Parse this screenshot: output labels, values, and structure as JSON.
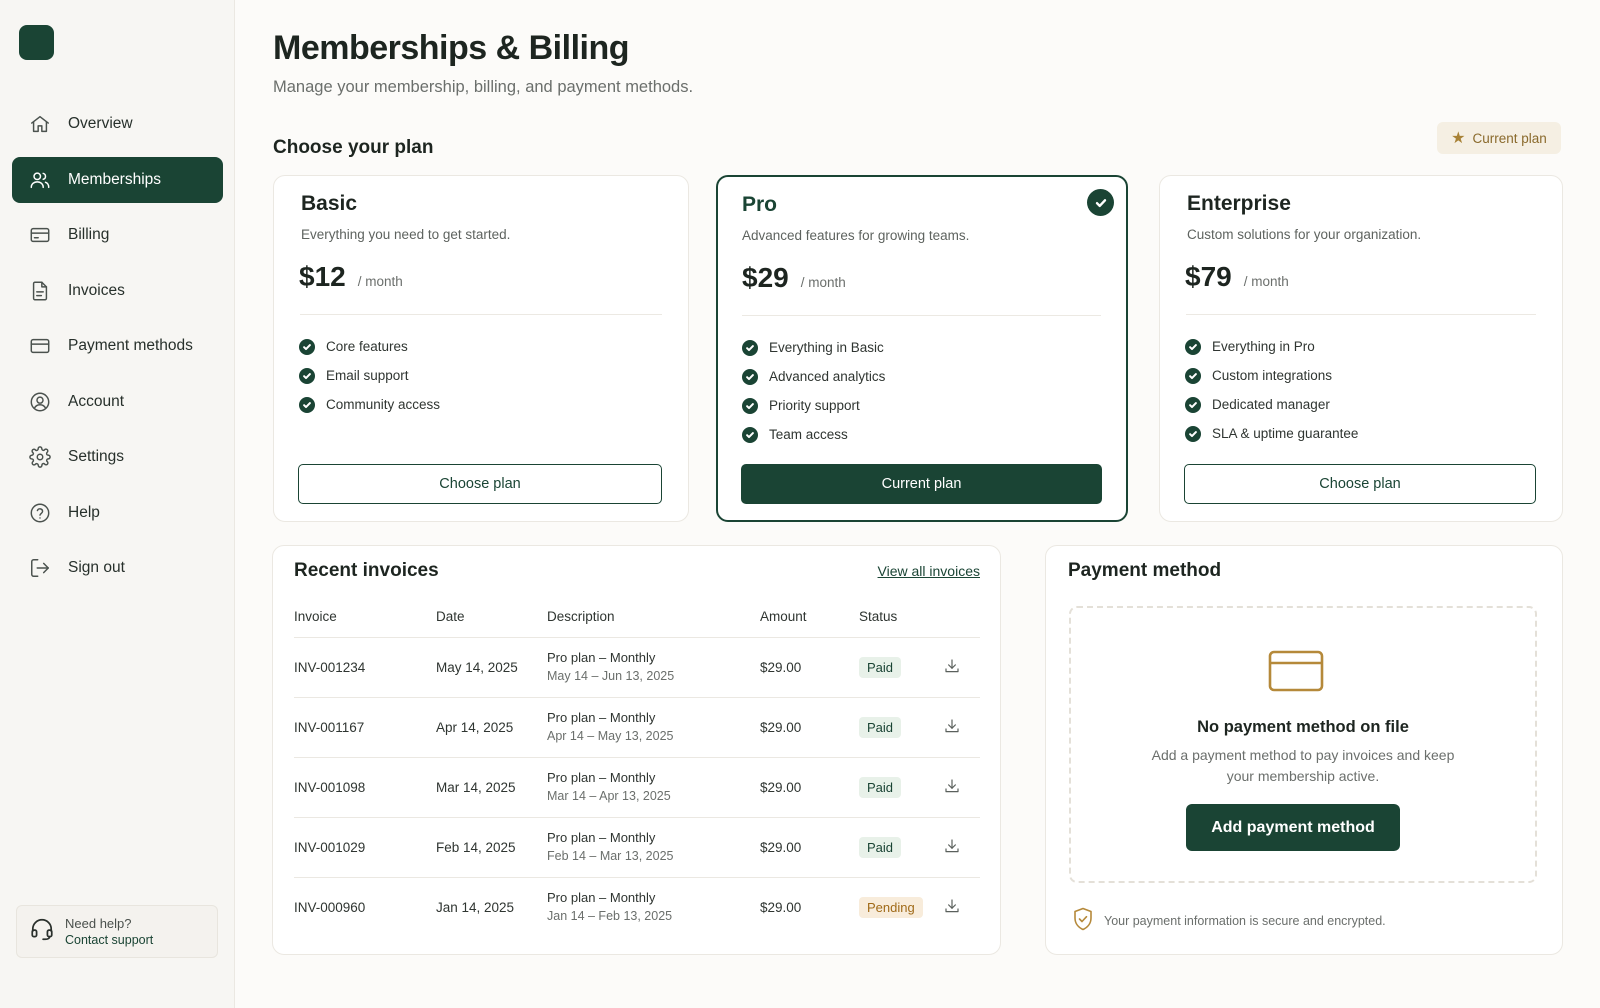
{
  "sidebar": {
    "items": [
      {
        "label": "Overview",
        "icon": "home-icon"
      },
      {
        "label": "Memberships",
        "icon": "users-icon",
        "active": true
      },
      {
        "label": "Billing",
        "icon": "credit-card-icon"
      },
      {
        "label": "Invoices",
        "icon": "file-icon"
      },
      {
        "label": "Payment methods",
        "icon": "credit-card-icon"
      },
      {
        "label": "Account",
        "icon": "user-circle-icon"
      },
      {
        "label": "Settings",
        "icon": "gear-icon"
      },
      {
        "label": "Help",
        "icon": "help-circle-icon"
      },
      {
        "label": "Sign out",
        "icon": "sign-out-icon"
      }
    ],
    "help": {
      "title": "Need help?",
      "link": "Contact support"
    }
  },
  "header": {
    "title": "Memberships & Billing",
    "subtitle": "Manage your membership, billing, and payment methods."
  },
  "plans_section": {
    "title": "Choose your plan",
    "current_pill": "Current plan"
  },
  "plans": [
    {
      "name": "Basic",
      "desc": "Everything you need to get started.",
      "price": "$12",
      "period": "/ month",
      "features": [
        "Core features",
        "Email support",
        "Community access"
      ],
      "button": "Choose plan"
    },
    {
      "name": "Pro",
      "desc": "Advanced features for growing teams.",
      "price": "$29",
      "period": "/ month",
      "features": [
        "Everything in Basic",
        "Advanced analytics",
        "Priority support",
        "Team access"
      ],
      "button": "Current plan"
    },
    {
      "name": "Enterprise",
      "desc": "Custom solutions for your organization.",
      "price": "$79",
      "period": "/ month",
      "features": [
        "Everything in Pro",
        "Custom integrations",
        "Dedicated manager",
        "SLA & uptime guarantee"
      ],
      "button": "Choose plan"
    }
  ],
  "invoices": {
    "title": "Recent invoices",
    "view_all": "View all invoices",
    "columns": [
      "Invoice",
      "Date",
      "Description",
      "Amount",
      "Status"
    ],
    "rows": [
      {
        "id": "INV-001234",
        "date": "May 14, 2025",
        "desc": "Pro plan – Monthly",
        "period": "May 14 – Jun 13, 2025",
        "amount": "$29.00",
        "status": "Paid"
      },
      {
        "id": "INV-001167",
        "date": "Apr 14, 2025",
        "desc": "Pro plan – Monthly",
        "period": "Apr 14 – May 13, 2025",
        "amount": "$29.00",
        "status": "Paid"
      },
      {
        "id": "INV-001098",
        "date": "Mar 14, 2025",
        "desc": "Pro plan – Monthly",
        "period": "Mar 14 – Apr 13, 2025",
        "amount": "$29.00",
        "status": "Paid"
      },
      {
        "id": "INV-001029",
        "date": "Feb 14, 2025",
        "desc": "Pro plan – Monthly",
        "period": "Feb 14 – Mar 13, 2025",
        "amount": "$29.00",
        "status": "Paid"
      },
      {
        "id": "INV-000960",
        "date": "Jan 14, 2025",
        "desc": "Pro plan – Monthly",
        "period": "Jan 14 – Feb 13, 2025",
        "amount": "$29.00",
        "status": "Pending"
      }
    ]
  },
  "payment": {
    "title": "Payment method",
    "empty_title": "No payment method on file",
    "empty_sub": "Add a payment method to pay invoices and keep your membership active.",
    "add_button": "Add payment method",
    "secure_note": "Your payment information is secure and encrypted."
  },
  "colors": {
    "brand": "#1a4434",
    "accent_gold": "#b5893a",
    "paid_bg": "#e8f1e9",
    "pending_bg": "#f8ecdb"
  }
}
